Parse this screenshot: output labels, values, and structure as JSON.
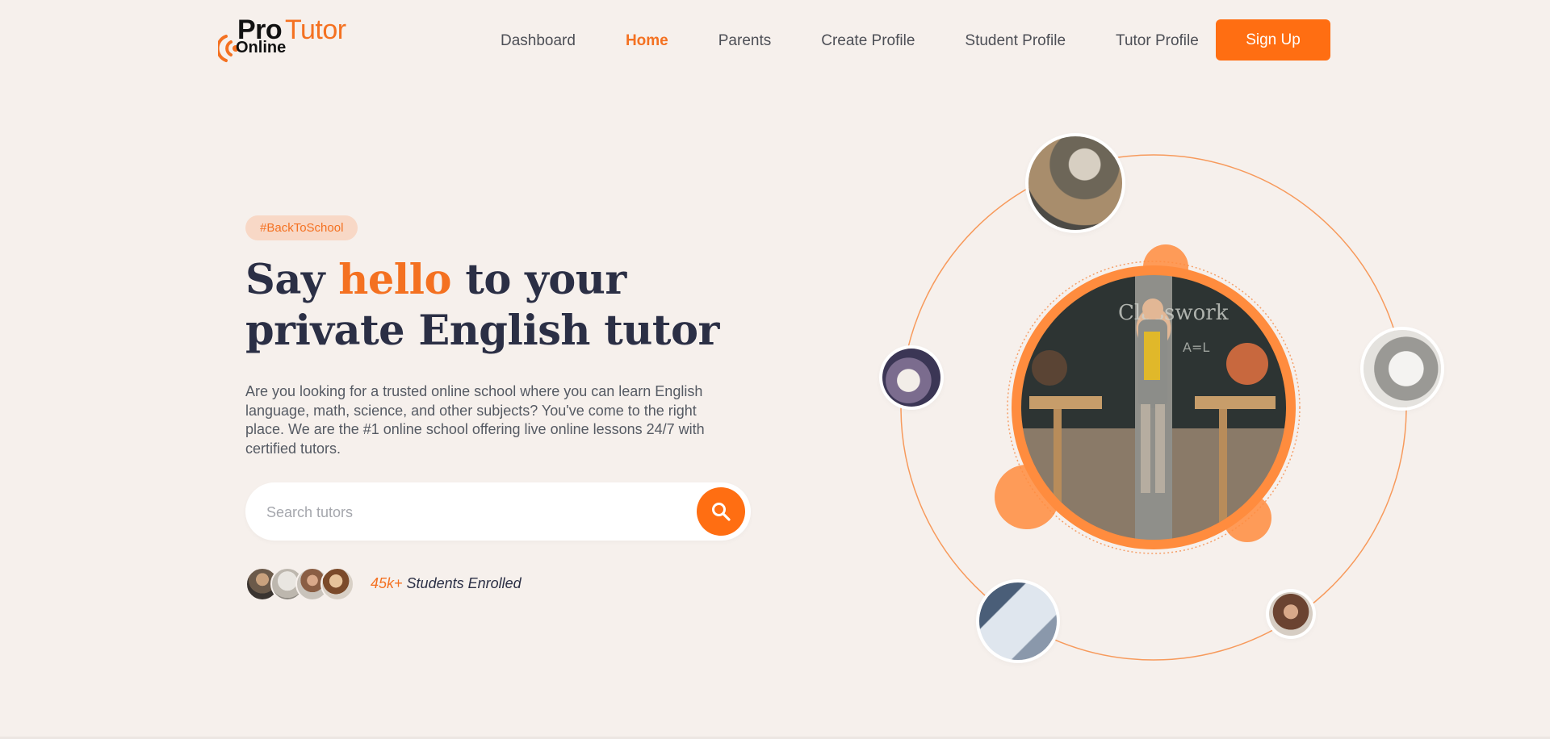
{
  "brand": {
    "pro": "Pro",
    "tutor": "Tutor",
    "online": "Online"
  },
  "nav": {
    "items": [
      {
        "label": "Dashboard",
        "active": false
      },
      {
        "label": "Home",
        "active": true
      },
      {
        "label": "Parents",
        "active": false
      },
      {
        "label": "Create Profile",
        "active": false
      },
      {
        "label": "Student Profile",
        "active": false
      },
      {
        "label": "Tutor Profile",
        "active": false
      }
    ],
    "signup_label": "Sign Up"
  },
  "hero": {
    "tag": "#BackToSchool",
    "headline_before": "Say ",
    "headline_highlight": "hello",
    "headline_after": " to your",
    "headline_line2": "private English tutor",
    "description": "Are you looking for a trusted online school where you can learn English language, math, science, and other subjects? You've come to the right place. We are the #1 online school offering live online lessons 24/7 with certified tutors.",
    "search": {
      "placeholder": "Search tutors",
      "value": ""
    },
    "enrolled_count": "45k+",
    "enrolled_label": " Students Enrolled"
  },
  "colors": {
    "accent": "#f47121",
    "button": "#ff6e12",
    "heading": "#2b2f45",
    "background": "#f6f0ec"
  },
  "icons": {
    "search": "search-icon",
    "logo": "signal-wave-icon"
  }
}
